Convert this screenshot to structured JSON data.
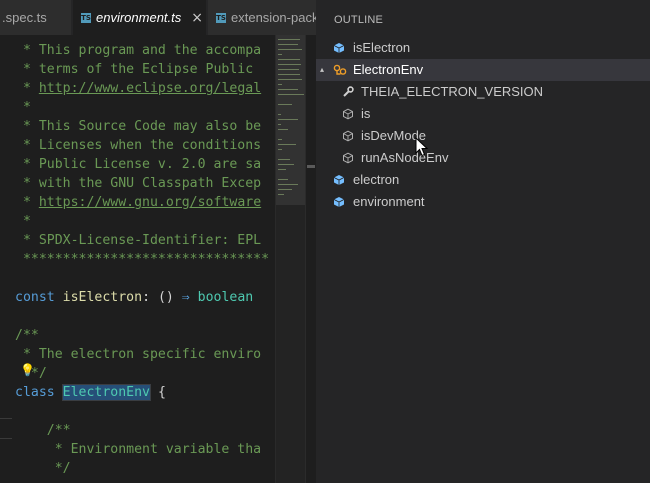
{
  "tabs": [
    {
      "label": ".spec.ts",
      "active": false,
      "italic": false
    },
    {
      "label": "environment.ts",
      "active": true,
      "italic": true,
      "icon": "TS",
      "close": "×"
    },
    {
      "label": "extension-pack",
      "active": false,
      "italic": false,
      "icon": "TS"
    }
  ],
  "editor": {
    "lines": [
      {
        "parts": [
          {
            "c": "cm",
            "t": " * This program and the accompa"
          }
        ]
      },
      {
        "parts": [
          {
            "c": "cm",
            "t": " * terms of the Eclipse Public "
          }
        ]
      },
      {
        "parts": [
          {
            "c": "cm",
            "t": " * "
          },
          {
            "c": "lnk",
            "t": "http://www.eclipse.org/legal"
          }
        ]
      },
      {
        "parts": [
          {
            "c": "cm",
            "t": " *"
          }
        ]
      },
      {
        "parts": [
          {
            "c": "cm",
            "t": " * This Source Code may also be"
          }
        ]
      },
      {
        "parts": [
          {
            "c": "cm",
            "t": " * Licenses when the conditions"
          }
        ]
      },
      {
        "parts": [
          {
            "c": "cm",
            "t": " * Public License v. 2.0 are sa"
          }
        ]
      },
      {
        "parts": [
          {
            "c": "cm",
            "t": " * with the GNU Classpath Excep"
          }
        ]
      },
      {
        "parts": [
          {
            "c": "cm",
            "t": " * "
          },
          {
            "c": "lnk",
            "t": "https://www.gnu.org/software"
          }
        ]
      },
      {
        "parts": [
          {
            "c": "cm",
            "t": " *"
          }
        ]
      },
      {
        "parts": [
          {
            "c": "cm",
            "t": " * SPDX-License-Identifier: EPL"
          }
        ]
      },
      {
        "parts": [
          {
            "c": "cm",
            "t": " *******************************"
          }
        ]
      },
      {
        "parts": []
      },
      {
        "parts": [
          {
            "c": "kw",
            "t": "const"
          },
          {
            "c": "",
            "t": " "
          },
          {
            "c": "fn",
            "t": "isElectron"
          },
          {
            "c": "",
            "t": ": () "
          },
          {
            "c": "kw",
            "t": "⇒"
          },
          {
            "c": "",
            "t": " "
          },
          {
            "c": "ty",
            "t": "boolean"
          }
        ]
      },
      {
        "parts": []
      },
      {
        "parts": [
          {
            "c": "cm",
            "t": "/**"
          }
        ]
      },
      {
        "parts": [
          {
            "c": "cm",
            "t": " * The electron specific enviro"
          }
        ]
      },
      {
        "parts": [
          {
            "c": "cm",
            "t": "  */"
          }
        ]
      },
      {
        "parts": [
          {
            "c": "kw",
            "t": "class"
          },
          {
            "c": "",
            "t": " "
          },
          {
            "c": "cls-hl",
            "t": "ElectronEnv"
          },
          {
            "c": "",
            "t": " {"
          }
        ]
      },
      {
        "parts": []
      },
      {
        "parts": [
          {
            "c": "cm",
            "t": "    /**"
          }
        ]
      },
      {
        "parts": [
          {
            "c": "cm",
            "t": "     * Environment variable tha"
          }
        ]
      },
      {
        "parts": [
          {
            "c": "cm",
            "t": "     */"
          }
        ]
      }
    ]
  },
  "outline": {
    "title": "OUTLINE",
    "items": [
      {
        "label": "isElectron",
        "icon": "variable-icon",
        "depth": 0,
        "twisty": ""
      },
      {
        "label": "ElectronEnv",
        "icon": "class-icon",
        "depth": 0,
        "twisty": "▴",
        "selected": true
      },
      {
        "label": "THEIA_ELECTRON_VERSION",
        "icon": "property-icon",
        "depth": 1,
        "twisty": ""
      },
      {
        "label": "is",
        "icon": "method-icon",
        "depth": 1,
        "twisty": ""
      },
      {
        "label": "isDevMode",
        "icon": "method-icon",
        "depth": 1,
        "twisty": ""
      },
      {
        "label": "runAsNodeEnv",
        "icon": "method-icon",
        "depth": 1,
        "twisty": ""
      },
      {
        "label": "electron",
        "icon": "variable-icon",
        "depth": 0,
        "twisty": ""
      },
      {
        "label": "environment",
        "icon": "variable-icon",
        "depth": 0,
        "twisty": ""
      }
    ]
  },
  "colors": {
    "variable_icon": "#75beff",
    "class_icon": "#ee9d28",
    "method_icon": "#b0b0b0",
    "selection": "#37373d"
  }
}
